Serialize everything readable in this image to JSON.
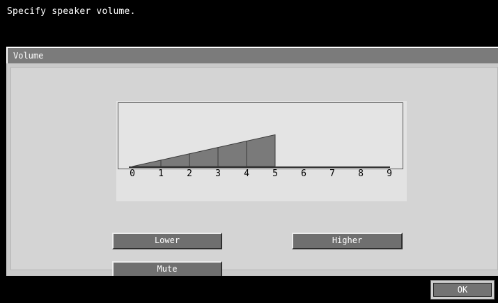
{
  "instruction": "Specify speaker volume.",
  "panel": {
    "title": "Volume"
  },
  "volume": {
    "min": 0,
    "max": 9,
    "level": 5,
    "scale_labels": [
      "0",
      "1",
      "2",
      "3",
      "4",
      "5",
      "6",
      "7",
      "8",
      "9"
    ]
  },
  "buttons": {
    "lower": "Lower",
    "higher": "Higher",
    "mute": "Mute",
    "ok": "OK"
  },
  "colors": {
    "filled_bar": "#7a7a7a",
    "background": "#000000"
  }
}
